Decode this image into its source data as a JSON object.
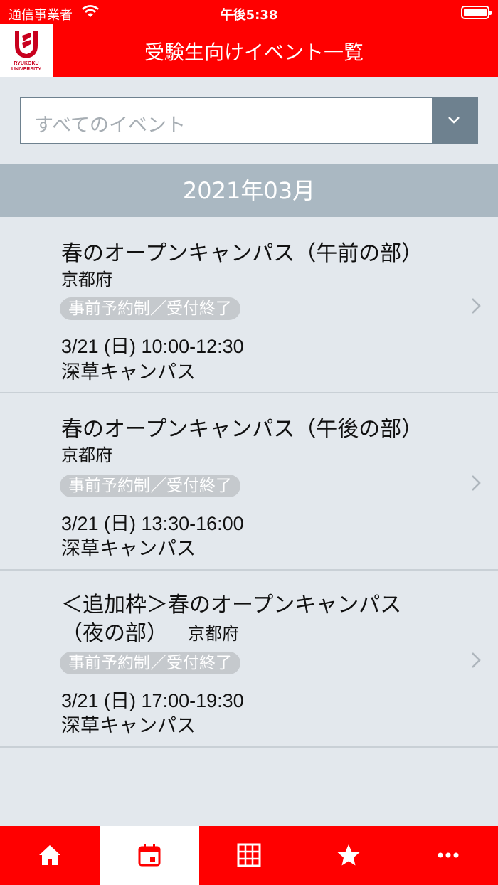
{
  "status_bar": {
    "carrier": "通信事業者",
    "time": "午後5:38"
  },
  "header": {
    "logo_text": "RYUKOKU UNIVERSITY",
    "title": "受験生向けイベント一覧"
  },
  "filter": {
    "value": "すべてのイベント"
  },
  "month_header": "2021年03月",
  "events": [
    {
      "title": "春のオープンキャンパス（午前の部）",
      "prefecture": "京都府",
      "badge": "事前予約制／受付終了",
      "date": "3/21 (日) 10:00-12:30",
      "place": "深草キャンパス"
    },
    {
      "title": "春のオープンキャンパス（午後の部）",
      "prefecture": "京都府",
      "badge": "事前予約制／受付終了",
      "date": "3/21 (日) 13:30-16:00",
      "place": "深草キャンパス"
    },
    {
      "title_line1": "＜追加枠＞春のオープンキャンパス",
      "title_line2": "（夜の部）",
      "prefecture": "京都府",
      "badge": "事前予約制／受付終了",
      "date": "3/21 (日) 17:00-19:30",
      "place": "深草キャンパス"
    }
  ],
  "tabbar": {
    "items": [
      {
        "icon": "home-icon",
        "active": false
      },
      {
        "icon": "calendar-icon",
        "active": true
      },
      {
        "icon": "grid-icon",
        "active": false
      },
      {
        "icon": "star-icon",
        "active": false
      },
      {
        "icon": "more-icon",
        "active": false
      }
    ]
  },
  "colors": {
    "brand_red": "#ff0000",
    "background": "#e3e8ed",
    "month_bar": "#aab8c2",
    "dropdown_button": "#6e818f",
    "badge": "#c5c9cd"
  }
}
